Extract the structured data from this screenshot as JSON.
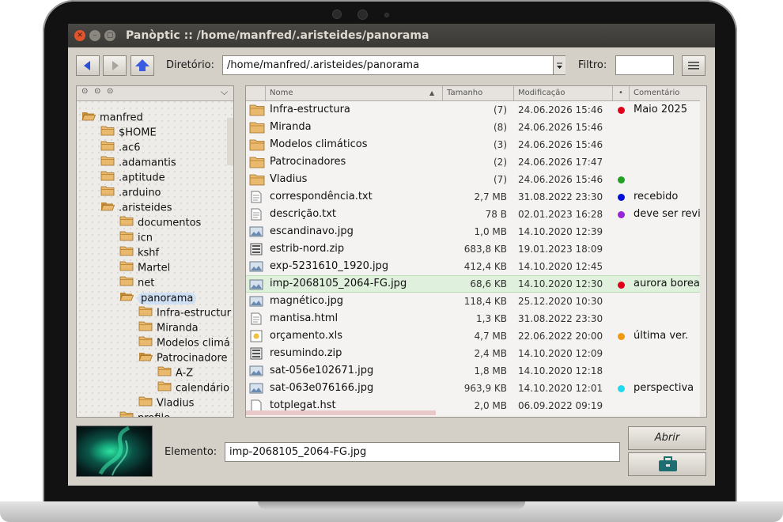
{
  "window": {
    "title": "Panòptic  ::  /home/manfred/.aristeides/panorama",
    "controls": [
      "close-icon",
      "minimize-icon",
      "maximize-icon"
    ]
  },
  "toolbar": {
    "directory_label": "Diretório:",
    "directory_value": "/home/manfred/.aristeides/panorama",
    "filter_label": "Filtro:",
    "filter_value": ""
  },
  "tree": {
    "header_icons": [
      "circle-icon",
      "circle-icon",
      "circle-icon",
      "chevron-down-icon"
    ],
    "nodes": [
      {
        "label": "manfred",
        "depth": 0,
        "open": true
      },
      {
        "label": "$HOME",
        "depth": 1
      },
      {
        "label": ".ac6",
        "depth": 1
      },
      {
        "label": ".adamantis",
        "depth": 1
      },
      {
        "label": ".aptitude",
        "depth": 1
      },
      {
        "label": ".arduino",
        "depth": 1
      },
      {
        "label": ".aristeides",
        "depth": 1,
        "open": true
      },
      {
        "label": "documentos",
        "depth": 2
      },
      {
        "label": "icn",
        "depth": 2
      },
      {
        "label": "kshf",
        "depth": 2
      },
      {
        "label": "Martel",
        "depth": 2
      },
      {
        "label": "net",
        "depth": 2
      },
      {
        "label": "panorama",
        "depth": 2,
        "open": true,
        "selected": true
      },
      {
        "label": "Infra-estructur",
        "depth": 3
      },
      {
        "label": "Miranda",
        "depth": 3
      },
      {
        "label": "Modelos climá",
        "depth": 3
      },
      {
        "label": "Patrocinadore",
        "depth": 3,
        "open": true
      },
      {
        "label": "A-Z",
        "depth": 4
      },
      {
        "label": "calendário",
        "depth": 4
      },
      {
        "label": "Vladius",
        "depth": 3
      },
      {
        "label": "profile",
        "depth": 2
      }
    ]
  },
  "list": {
    "columns": {
      "name": "Nome",
      "size": "Tamanho",
      "modified": "Modificação",
      "flag": "•",
      "comment": "Comentário"
    },
    "rows": [
      {
        "icon": "folder",
        "name": "Infra-estructura",
        "size": "(7)",
        "date": "24.06.2026 15:46",
        "dot": "#e0001a",
        "comment": "Maio 2025"
      },
      {
        "icon": "folder",
        "name": "Miranda",
        "size": "(8)",
        "date": "24.06.2026 15:46",
        "dot": "",
        "comment": ""
      },
      {
        "icon": "folder",
        "name": "Modelos climáticos",
        "size": "(3)",
        "date": "24.06.2026 15:46",
        "dot": "",
        "comment": ""
      },
      {
        "icon": "folder",
        "name": "Patrocinadores",
        "size": "(2)",
        "date": "24.06.2026 17:47",
        "dot": "",
        "comment": ""
      },
      {
        "icon": "folder",
        "name": "Vladius",
        "size": "(7)",
        "date": "24.06.2026 15:46",
        "dot": "#22a022",
        "comment": ""
      },
      {
        "icon": "text",
        "name": "correspondência.txt",
        "size": "2,7 MB",
        "date": "31.08.2022 23:30",
        "dot": "#0010d8",
        "comment": "recebido"
      },
      {
        "icon": "text",
        "name": "descrição.txt",
        "size": "78 B",
        "date": "02.01.2023 16:28",
        "dot": "#9a22d8",
        "comment": "deve ser revi"
      },
      {
        "icon": "image",
        "name": "escandinavo.jpg",
        "size": "1,0 MB",
        "date": "14.10.2020 12:39",
        "dot": "",
        "comment": ""
      },
      {
        "icon": "zip",
        "name": "estrib-nord.zip",
        "size": "683,8 KB",
        "date": "19.01.2023 18:09",
        "dot": "",
        "comment": ""
      },
      {
        "icon": "image",
        "name": "exp-5231610_1920.jpg",
        "size": "412,4 KB",
        "date": "14.10.2020 12:45",
        "dot": "",
        "comment": ""
      },
      {
        "icon": "image",
        "name": "imp-2068105_2064-FG.jpg",
        "size": "68,6 KB",
        "date": "14.10.2020 12:30",
        "dot": "#e0001a",
        "comment": "aurora boreal",
        "selected": true
      },
      {
        "icon": "image",
        "name": "magnético.jpg",
        "size": "118,4 KB",
        "date": "25.12.2020 10:30",
        "dot": "",
        "comment": ""
      },
      {
        "icon": "text",
        "name": "mantisa.html",
        "size": "1,3 KB",
        "date": "31.08.2022 23:30",
        "dot": "",
        "comment": ""
      },
      {
        "icon": "sheet",
        "name": "orçamento.xls",
        "size": "4,7 MB",
        "date": "22.06.2022 20:00",
        "dot": "#f09a10",
        "comment": "última ver."
      },
      {
        "icon": "zip",
        "name": "resumindo.zip",
        "size": "2,4 MB",
        "date": "14.10.2020 12:09",
        "dot": "",
        "comment": ""
      },
      {
        "icon": "image",
        "name": "sat-056e102671.jpg",
        "size": "1,8 MB",
        "date": "14.10.2020 12:18",
        "dot": "",
        "comment": ""
      },
      {
        "icon": "image",
        "name": "sat-063e076166.jpg",
        "size": "963,9 KB",
        "date": "14.10.2020 12:01",
        "dot": "#20d8f0",
        "comment": "perspectiva"
      },
      {
        "icon": "file",
        "name": "totplegat.hst",
        "size": "2,0 MB",
        "date": "06.09.2022 09:19",
        "dot": "",
        "comment": ""
      }
    ]
  },
  "bottom": {
    "element_label": "Elemento:",
    "element_value": "imp-2068105_2064-FG.jpg",
    "open_button": "Abrir",
    "briefcase_icon": "briefcase-icon"
  }
}
